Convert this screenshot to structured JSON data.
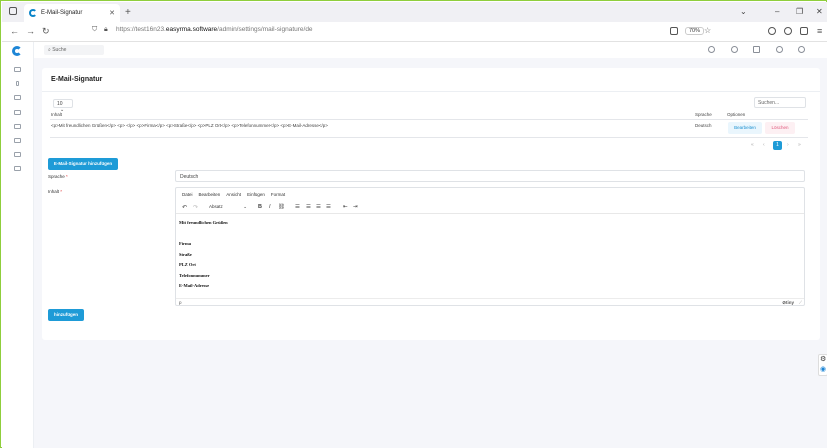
{
  "browser": {
    "tab_title": "E-Mail-Signatur",
    "tab_close": "✕",
    "new_tab": "+",
    "url_prefix": "https://test16n23.",
    "url_domain": "easyrma.software",
    "url_path": "/admin/settings/mail-signature/de",
    "zoom": "70%",
    "window_controls": [
      "⌄",
      "–",
      "❐",
      "✕"
    ]
  },
  "app": {
    "search_placeholder": "Suche"
  },
  "card": {
    "title": "E-Mail-Signatur",
    "page_length": "10",
    "table_search_placeholder": "Suchen...",
    "columns": [
      "Inhalt",
      "Sprache",
      "Optionen"
    ],
    "rows": [
      {
        "content": "<p>Mit freundlichen Grüßen</p> <p> </p> <p>Firma</p> <p>Straße</p> <p>PLZ Ort</p> <p>Telefonnummer</p> <p>E-Mail-Adresse</p>",
        "language": "Deutsch",
        "edit_label": "Bearbeiten",
        "delete_label": "Löschen"
      }
    ],
    "pagination": {
      "first": "«",
      "prev": "‹",
      "current": "1",
      "next": "›",
      "last": "»"
    },
    "add_signature_button": "E-Mail-Signatur hinzufügen",
    "form": {
      "language_label": "Sprache",
      "language_value": "Deutsch",
      "content_label": "Inhalt",
      "required_mark": "*",
      "editor": {
        "menu": [
          "Datei",
          "Bearbeiten",
          "Ansicht",
          "Einfügen",
          "Format"
        ],
        "block_format": "Absatz",
        "content_lines": [
          "Mit freundlichen Grüßen",
          "",
          "Firma",
          "Straße",
          "PLZ Ort",
          "Telefonnummer",
          "E-Mail-Adresse"
        ],
        "status_path": "p",
        "brand": "tiny"
      },
      "submit_button": "hinzufügen"
    }
  }
}
